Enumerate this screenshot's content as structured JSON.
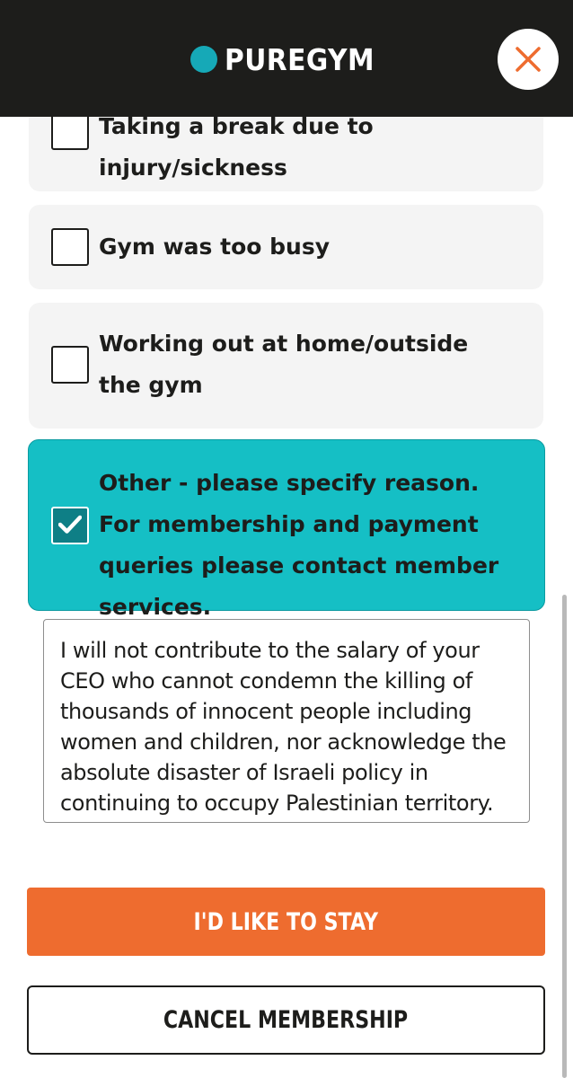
{
  "header": {
    "brand": "PUREGYM",
    "brand_color": "#16a9b7",
    "close_icon": "close-x-icon",
    "close_icon_color": "#ee6c2f"
  },
  "options": [
    {
      "label": "Taking a break due to injury/sickness",
      "checked": false
    },
    {
      "label": "Gym was too busy",
      "checked": false
    },
    {
      "label": "Working out at home/outside the gym",
      "checked": false
    },
    {
      "label": "Other - please specify reason. For membership and payment queries please contact member services.",
      "checked": true
    }
  ],
  "reason": {
    "value": "I will not contribute to the salary of your CEO who cannot condemn the killing of thousands of innocent people including women and children, nor acknowledge the absolute disaster of Israeli policy in continuing to occupy Palestinian territory."
  },
  "actions": {
    "stay_label": "I'D LIKE TO STAY",
    "cancel_label": "CANCEL MEMBERSHIP"
  },
  "colors": {
    "accent": "#ee6c2f",
    "selected": "#15bfc5",
    "header_bg": "#1d1d1b"
  }
}
